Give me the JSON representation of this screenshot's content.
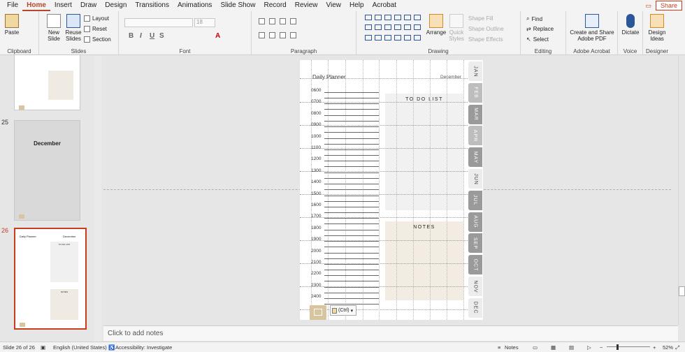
{
  "tabs": [
    "File",
    "Home",
    "Insert",
    "Draw",
    "Design",
    "Transitions",
    "Animations",
    "Slide Show",
    "Record",
    "Review",
    "View",
    "Help",
    "Acrobat"
  ],
  "active_tab": "Home",
  "share_label": "Share",
  "ribbon": {
    "clipboard": {
      "paste": "Paste",
      "label": "Clipboard"
    },
    "slides": {
      "new_slide": "New Slide",
      "reuse": "Reuse Slides",
      "layout": "Layout",
      "reset": "Reset",
      "section": "Section",
      "label": "Slides"
    },
    "font": {
      "label": "Font",
      "size": "18"
    },
    "paragraph": {
      "label": "Paragraph"
    },
    "drawing": {
      "arrange": "Arrange",
      "quick_styles": "Quick Styles",
      "shape_fill": "Shape Fill",
      "shape_outline": "Shape Outline",
      "shape_effects": "Shape Effects",
      "label": "Drawing"
    },
    "editing": {
      "find": "Find",
      "replace": "Replace",
      "select": "Select",
      "label": "Editing"
    },
    "acrobat": {
      "create": "Create and Share Adobe PDF",
      "label": "Adobe Acrobat"
    },
    "voice": {
      "dictate": "Dictate",
      "label": "Voice"
    },
    "designer": {
      "ideas": "Design Ideas",
      "label": "Designer"
    }
  },
  "thumbnails": [
    {
      "num": "25",
      "title": "December"
    },
    {
      "num": "26",
      "title": "Daily Planner",
      "date": "December",
      "todo": "TO DO LIST",
      "notes": "NOTES"
    }
  ],
  "slide": {
    "title": "Daily Planner",
    "month": "December",
    "todo_label": "TO DO LIST",
    "notes_label": "NOTES",
    "hours": [
      "0600",
      "0700",
      "0800",
      "0900",
      "1000",
      "1100",
      "1200",
      "1300",
      "1400",
      "1500",
      "1600",
      "1700",
      "1800",
      "1900",
      "2000",
      "2100",
      "2200",
      "2300",
      "2400"
    ],
    "months": [
      "JAN",
      "FEB",
      "MAR",
      "APR",
      "MAY",
      "JUN",
      "JUL",
      "AUG",
      "SEP",
      "OCT",
      "NOV",
      "DEC"
    ],
    "paste_ctrl": "(Ctrl)"
  },
  "notes_placeholder": "Click to add notes",
  "status": {
    "slide": "Slide 26 of 26",
    "language": "English (United States)",
    "accessibility": "Accessibility: Investigate",
    "notes": "Notes",
    "zoom": "52%"
  }
}
